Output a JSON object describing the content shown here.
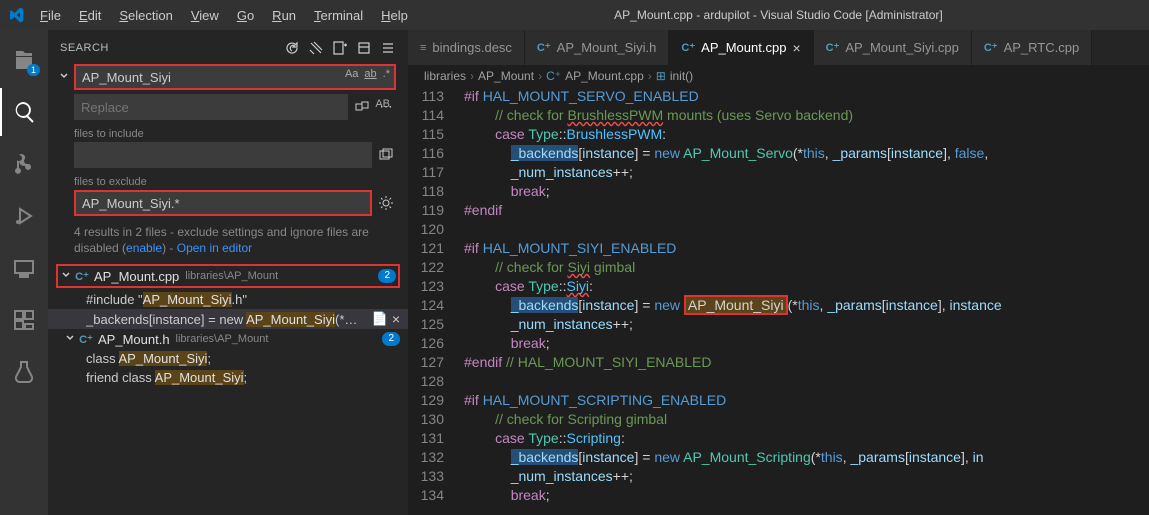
{
  "title": "AP_Mount.cpp - ardupilot - Visual Studio Code [Administrator]",
  "menu": [
    "File",
    "Edit",
    "Selection",
    "View",
    "Go",
    "Run",
    "Terminal",
    "Help"
  ],
  "sidebar": {
    "header": "SEARCH",
    "search_value": "AP_Mount_Siyi",
    "replace_placeholder": "Replace",
    "include_label": "files to include",
    "include_value": "",
    "exclude_label": "files to exclude",
    "exclude_value": "AP_Mount_Siyi.*",
    "case_label": "Aa",
    "word_label": "ab",
    "regex_label": ".*",
    "all_caps_label": "AB",
    "results_text_a": "4 results in 2 files - exclude settings and ignore files are disabled (",
    "results_text_enable": "enable",
    "results_text_b": ") - ",
    "results_text_open": "Open in editor",
    "files": [
      {
        "name": "AP_Mount.cpp",
        "path": "libraries\\AP_Mount",
        "badge": "2",
        "badge_blue": true,
        "matches": [
          {
            "pre": "#include \"",
            "term": "AP_Mount_Siyi",
            "post": ".h\""
          },
          {
            "pre": "_backends[instance] = new ",
            "term": "AP_Mount_Siyi",
            "post": "(*…",
            "selected": true,
            "showclose": true,
            "icon": "📄"
          }
        ]
      },
      {
        "name": "AP_Mount.h",
        "path": "libraries\\AP_Mount",
        "badge": "2",
        "badge_blue": true,
        "matches": [
          {
            "pre": "class ",
            "term": "AP_Mount_Siyi",
            "post": ";"
          },
          {
            "pre": "friend class ",
            "term": "AP_Mount_Siyi",
            "post": ";"
          }
        ]
      }
    ]
  },
  "tabs": [
    {
      "icon": "≡",
      "color": "#a074c4",
      "label": "bindings.desc",
      "active": false
    },
    {
      "icon": "C⁺",
      "color": "#519aba",
      "label": "AP_Mount_Siyi.h",
      "active": false
    },
    {
      "icon": "C⁺",
      "color": "#519aba",
      "label": "AP_Mount.cpp",
      "active": true,
      "close": true
    },
    {
      "icon": "C⁺",
      "color": "#519aba",
      "label": "AP_Mount_Siyi.cpp",
      "active": false
    },
    {
      "icon": "C⁺",
      "color": "#519aba",
      "label": "AP_RTC.cpp",
      "active": false
    }
  ],
  "breadcrumbs": [
    "libraries",
    "AP_Mount",
    "AP_Mount.cpp",
    "init()"
  ],
  "bc_icons": [
    "",
    "",
    "C⁺",
    "⊞"
  ],
  "code": [
    {
      "n": 113,
      "html": "<span class='tok-pp'>#if</span> <span class='tok-mac'>HAL_MOUNT_SERVO_ENABLED</span>"
    },
    {
      "n": 114,
      "html": "        <span class='tok-cm'>// check for <span class='squiggle'>BrushlessPWM</span> mounts (uses Servo backend)</span>"
    },
    {
      "n": 115,
      "html": "        <span class='tok-kw'>case</span> <span class='tok-type'>Type</span>::<span class='tok-enum'>BrushlessPWM</span>:"
    },
    {
      "n": 116,
      "html": "            <span class='tok-sel tok-id'>_backends</span>[<span class='tok-id'>instance</span>] = <span class='tok-kw2'>new</span> <span class='tok-type'>AP_Mount_Servo</span>(*<span class='tok-kw2'>this</span>, <span class='tok-id'>_params</span>[<span class='tok-id'>instance</span>], <span class='tok-kw2'>false</span>, "
    },
    {
      "n": 117,
      "html": "            <span class='tok-id'>_num_instances</span>++;"
    },
    {
      "n": 118,
      "html": "            <span class='tok-kw'>break</span>;"
    },
    {
      "n": 119,
      "html": "<span class='tok-pp'>#endif</span>"
    },
    {
      "n": 120,
      "html": ""
    },
    {
      "n": 121,
      "html": "<span class='tok-pp'>#if</span> <span class='tok-mac'>HAL_MOUNT_SIYI_ENABLED</span>"
    },
    {
      "n": 122,
      "html": "        <span class='tok-cm'>// check for <span class='squiggle'>Siyi</span> gimbal</span>"
    },
    {
      "n": 123,
      "html": "        <span class='tok-kw'>case</span> <span class='tok-type'>Type</span>::<span class='tok-enum squiggle'>Siyi</span>:"
    },
    {
      "n": 124,
      "html": "            <span class='tok-sel tok-id'>_backends</span>[<span class='tok-id'>instance</span>] = <span class='tok-kw2'>new</span> <span class='tok-hl'>AP_Mount_Siyi</span>(*<span class='tok-kw2'>this</span>, <span class='tok-id'>_params</span>[<span class='tok-id'>instance</span>], <span class='tok-id'>instance</span>"
    },
    {
      "n": 125,
      "html": "            <span class='tok-id'>_num_instances</span>++;"
    },
    {
      "n": 126,
      "html": "            <span class='tok-kw'>break</span>;"
    },
    {
      "n": 127,
      "html": "<span class='tok-pp'>#endif</span> <span class='tok-cm'>// HAL_MOUNT_SIYI_ENABLED</span>"
    },
    {
      "n": 128,
      "html": ""
    },
    {
      "n": 129,
      "html": "<span class='tok-pp'>#if</span> <span class='tok-mac'>HAL_MOUNT_SCRIPTING_ENABLED</span>"
    },
    {
      "n": 130,
      "html": "        <span class='tok-cm'>// check for Scripting gimbal</span>"
    },
    {
      "n": 131,
      "html": "        <span class='tok-kw'>case</span> <span class='tok-type'>Type</span>::<span class='tok-enum'>Scripting</span>:"
    },
    {
      "n": 132,
      "html": "            <span class='tok-sel tok-id'>_backends</span>[<span class='tok-id'>instance</span>] = <span class='tok-kw2'>new</span> <span class='tok-type'>AP_Mount_Scripting</span>(*<span class='tok-kw2'>this</span>, <span class='tok-id'>_params</span>[<span class='tok-id'>instance</span>], <span class='tok-id'>in</span>"
    },
    {
      "n": 133,
      "html": "            <span class='tok-id'>_num_instances</span>++;"
    },
    {
      "n": 134,
      "html": "            <span class='tok-kw'>break</span>;"
    }
  ],
  "activity_badge": "1"
}
